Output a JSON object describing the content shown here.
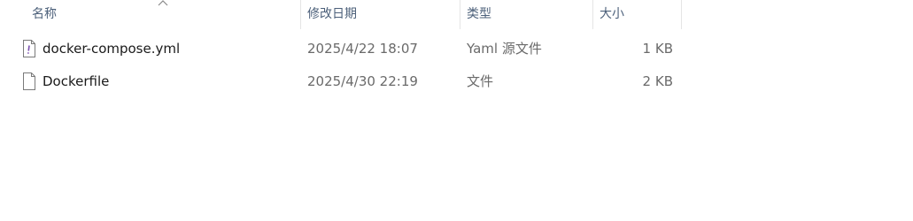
{
  "columns": {
    "name": "名称",
    "date_modified": "修改日期",
    "type": "类型",
    "size": "大小"
  },
  "sort": {
    "column": "name",
    "direction": "ascending",
    "icon": "chevron-up-icon"
  },
  "files": [
    {
      "name": "docker-compose.yml",
      "date_modified": "2025/4/22 18:07",
      "type": "Yaml 源文件",
      "size": "1 KB",
      "icon": "yaml-file-icon"
    },
    {
      "name": "Dockerfile",
      "date_modified": "2025/4/30 22:19",
      "type": "文件",
      "size": "2 KB",
      "icon": "generic-file-icon"
    }
  ],
  "colors": {
    "header_text": "#4c607a",
    "secondary_text": "#6a6a6a",
    "primary_text": "#1a1a1a",
    "column_divider": "#e5e5e5"
  }
}
